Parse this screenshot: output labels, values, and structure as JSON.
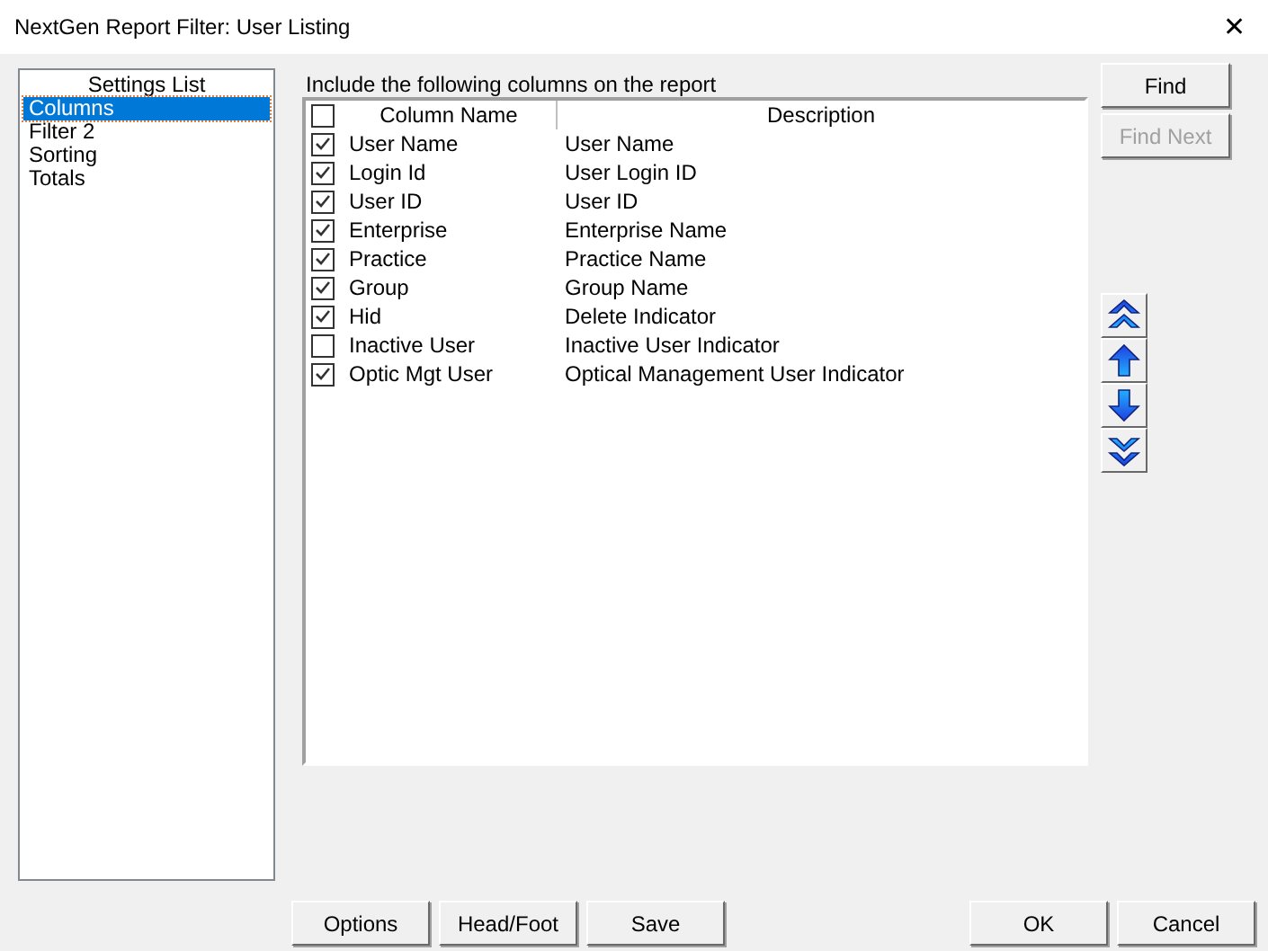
{
  "window": {
    "title": "NextGen Report Filter: User Listing",
    "close": "✕"
  },
  "settings_list": {
    "title": "Settings List",
    "items": [
      {
        "label": "Columns",
        "selected": true
      },
      {
        "label": "Filter 2",
        "selected": false
      },
      {
        "label": "Sorting",
        "selected": false
      },
      {
        "label": "Totals",
        "selected": false
      }
    ]
  },
  "columns_panel": {
    "caption": "Include the following columns on the report",
    "header": {
      "checked": false,
      "column_name": "Column Name",
      "description": "Description"
    },
    "rows": [
      {
        "checked": true,
        "name": "User Name",
        "description": "User Name"
      },
      {
        "checked": true,
        "name": "Login Id",
        "description": "User Login ID"
      },
      {
        "checked": true,
        "name": "User ID",
        "description": "User ID"
      },
      {
        "checked": true,
        "name": "Enterprise",
        "description": "Enterprise Name"
      },
      {
        "checked": true,
        "name": "Practice",
        "description": "Practice Name"
      },
      {
        "checked": true,
        "name": "Group",
        "description": "Group Name"
      },
      {
        "checked": true,
        "name": "Hid",
        "description": "Delete Indicator"
      },
      {
        "checked": false,
        "name": "Inactive User",
        "description": "Inactive User Indicator"
      },
      {
        "checked": true,
        "name": "Optic Mgt User",
        "description": "Optical Management User Indicator"
      }
    ]
  },
  "side_buttons": [
    {
      "label": "Find",
      "disabled": false
    },
    {
      "label": "Find Next",
      "disabled": true
    }
  ],
  "move_buttons": [
    {
      "kind": "top"
    },
    {
      "kind": "up"
    },
    {
      "kind": "down"
    },
    {
      "kind": "bottom"
    }
  ],
  "footer_left": [
    "Options",
    "Head/Foot",
    "Save"
  ],
  "footer_right": [
    "OK",
    "Cancel"
  ]
}
